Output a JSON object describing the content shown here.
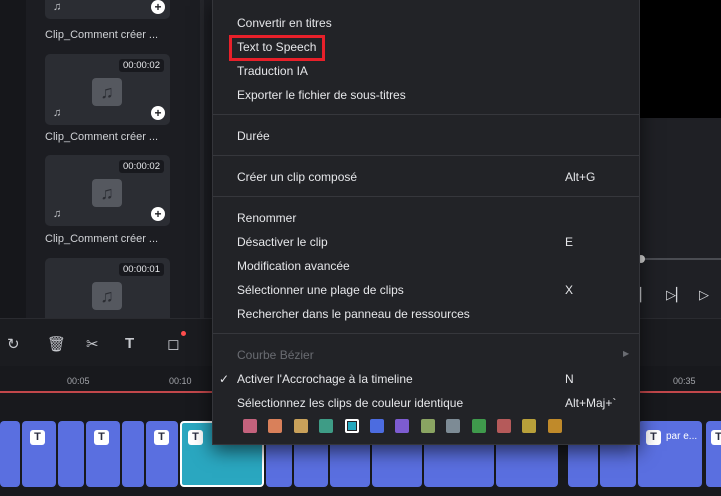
{
  "media": {
    "items": [
      {
        "label": "Clip_Comment créer ...",
        "duration": ""
      },
      {
        "label": "Clip_Comment créer ...",
        "duration": "00:00:02"
      },
      {
        "label": "Clip_Comment créer ...",
        "duration": "00:00:02"
      },
      {
        "label": "",
        "duration": "00:00:01"
      }
    ]
  },
  "ruler": {
    "ticks": [
      "00:05",
      "00:10",
      "00:35"
    ]
  },
  "track": {
    "clip_text": "par e..."
  },
  "menu": {
    "items": [
      {
        "label": "Convertir en titres",
        "shortcut": ""
      },
      {
        "label": "Text to Speech",
        "shortcut": "",
        "highlighted": true
      },
      {
        "label": "Traduction IA",
        "shortcut": ""
      },
      {
        "label": "Exporter le fichier de sous-titres",
        "shortcut": ""
      },
      {
        "label": "Durée",
        "shortcut": ""
      },
      {
        "label": "Créer un clip composé",
        "shortcut": "Alt+G"
      },
      {
        "label": "Renommer",
        "shortcut": ""
      },
      {
        "label": "Désactiver le clip",
        "shortcut": "E"
      },
      {
        "label": "Modification avancée",
        "shortcut": ""
      },
      {
        "label": "Sélectionner une plage de clips",
        "shortcut": "X"
      },
      {
        "label": "Rechercher dans le panneau de ressources",
        "shortcut": ""
      },
      {
        "label": "Courbe Bézier",
        "shortcut": "",
        "disabled": true
      },
      {
        "label": "Activer l'Accrochage à la timeline",
        "shortcut": "N",
        "checked": true
      },
      {
        "label": "Sélectionnez les clips de couleur identique",
        "shortcut": "Alt+Maj+`"
      }
    ],
    "colors": [
      "#c4627d",
      "#d9805a",
      "#c9a15a",
      "#3e9c86",
      "#23a9bf",
      "#4c6ce0",
      "#7d5cd1",
      "#8aa462",
      "#7d8b95",
      "#3f9a4c",
      "#b55a5a",
      "#b8a03a",
      "#c08a2a"
    ],
    "selected_color_index": 4
  },
  "icons": [
    "note-icon",
    "waveform-icon",
    "plus-icon",
    "redo-icon",
    "trash-icon",
    "scissors-icon",
    "text-tool-icon",
    "crop-icon",
    "check-icon",
    "play-icon",
    "step-forward-icon"
  ]
}
